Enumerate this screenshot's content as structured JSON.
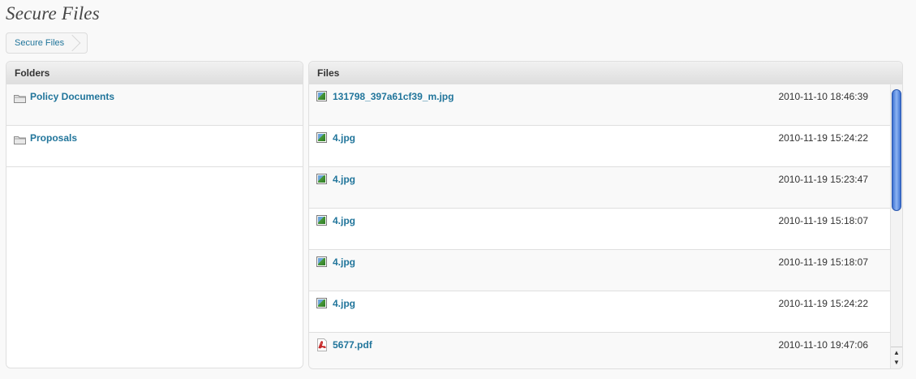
{
  "page": {
    "title": "Secure Files"
  },
  "breadcrumb": {
    "items": [
      "Secure Files"
    ]
  },
  "folders": {
    "header": "Folders",
    "items": [
      {
        "name": "Policy Documents",
        "icon": "folder-icon"
      },
      {
        "name": "Proposals",
        "icon": "folder-icon"
      }
    ]
  },
  "files": {
    "header": "Files",
    "items": [
      {
        "name": "131798_397a61cf39_m.jpg",
        "date": "2010-11-10 18:46:39",
        "icon": "image-file-icon"
      },
      {
        "name": "4.jpg",
        "date": "2010-11-19 15:24:22",
        "icon": "image-file-icon"
      },
      {
        "name": "4.jpg",
        "date": "2010-11-19 15:23:47",
        "icon": "image-file-icon"
      },
      {
        "name": "4.jpg",
        "date": "2010-11-19 15:18:07",
        "icon": "image-file-icon"
      },
      {
        "name": "4.jpg",
        "date": "2010-11-19 15:18:07",
        "icon": "image-file-icon"
      },
      {
        "name": "4.jpg",
        "date": "2010-11-19 15:24:22",
        "icon": "image-file-icon"
      },
      {
        "name": "5677.pdf",
        "date": "2010-11-10 19:47:06",
        "icon": "pdf-file-icon"
      }
    ]
  },
  "colors": {
    "link": "#21759b",
    "scroll_thumb": "#3b6fd2",
    "pdf": "#c62828"
  }
}
